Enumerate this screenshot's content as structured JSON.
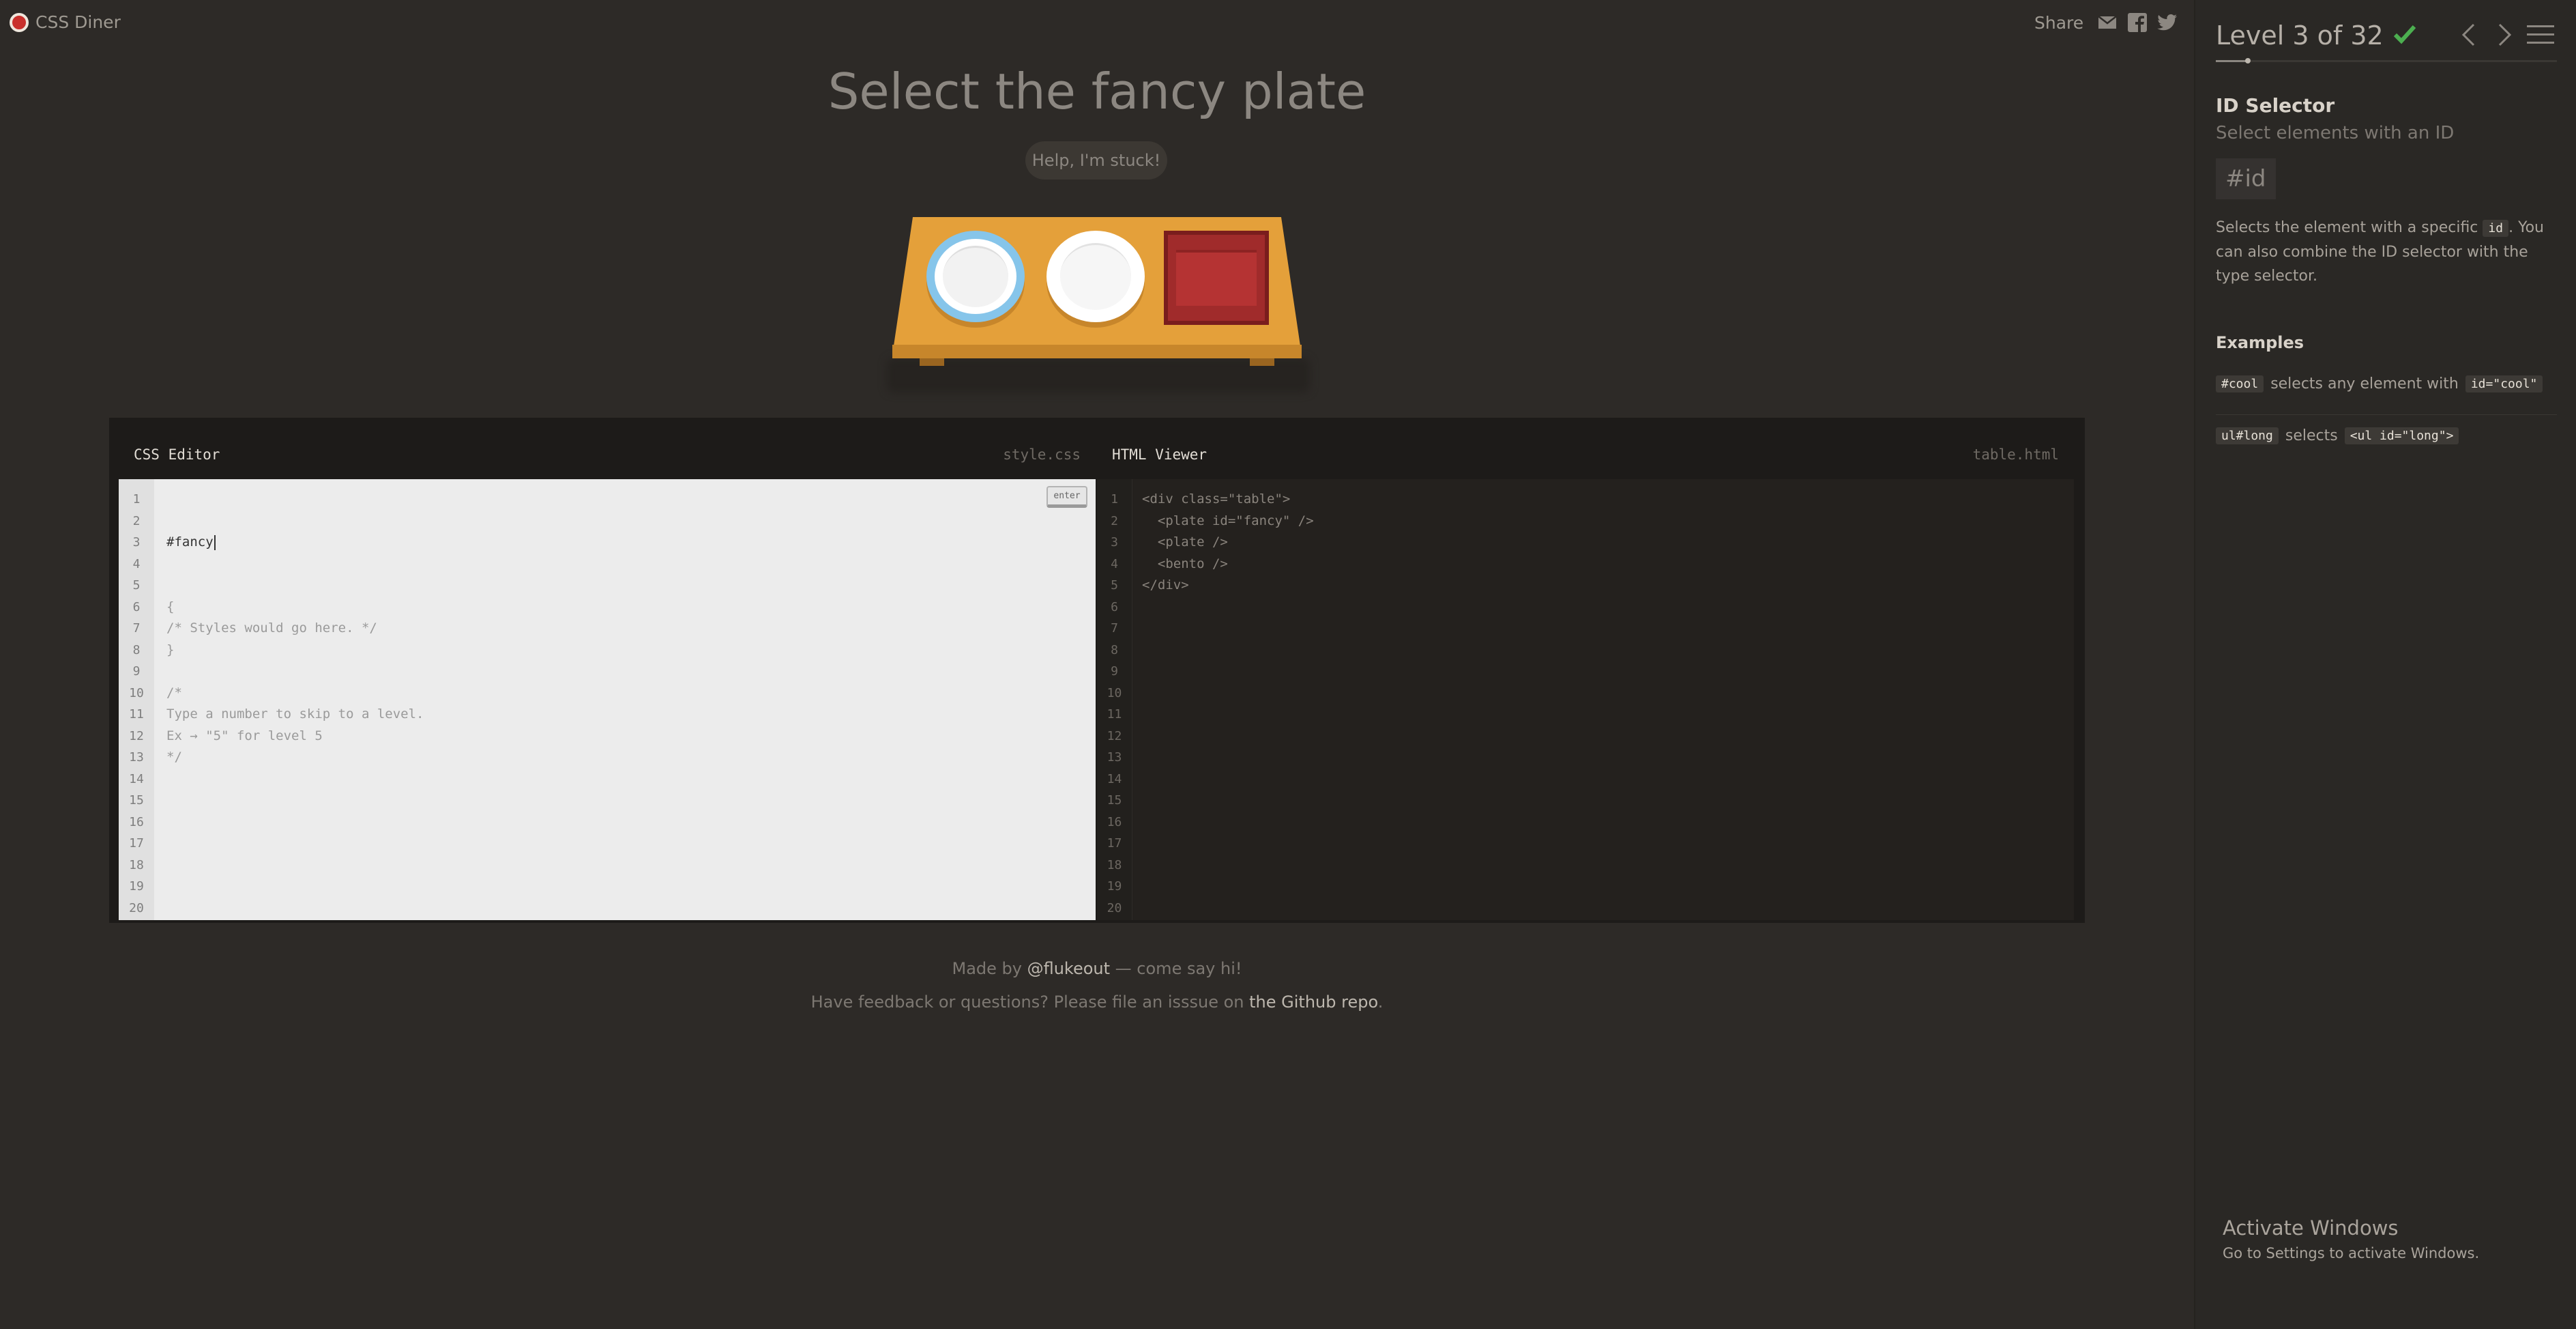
{
  "app": {
    "name": "CSS Diner"
  },
  "share": {
    "label": "Share",
    "icons": [
      "mail-icon",
      "facebook-icon",
      "twitter-icon"
    ]
  },
  "level": {
    "instruction": "Select the fancy plate",
    "help_label": "Help, I'm stuck!",
    "counter": "Level 3 of 32",
    "completed": true,
    "progress_fraction": 0.094
  },
  "css_editor": {
    "title": "CSS Editor",
    "filename": "style.css",
    "enter_label": "enter",
    "input_value": "#fancy",
    "line_numbers": [
      "1",
      "2",
      "3",
      "4",
      "5",
      "6",
      "7",
      "8",
      "9",
      "10",
      "11",
      "12",
      "13",
      "14",
      "15",
      "16",
      "17",
      "18",
      "19",
      "20"
    ],
    "lines": [
      "{",
      "/* Styles would go here. */",
      "}",
      "",
      "/*",
      "Type a number to skip to a level.",
      "Ex → \"5\" for level 5",
      "*/"
    ]
  },
  "html_viewer": {
    "title": "HTML Viewer",
    "filename": "table.html",
    "line_numbers": [
      "1",
      "2",
      "3",
      "4",
      "5",
      "6",
      "7",
      "8",
      "9",
      "10",
      "11",
      "12",
      "13",
      "14",
      "15",
      "16",
      "17",
      "18",
      "19",
      "20"
    ],
    "lines": [
      "<div class=\"table\">",
      "  <plate id=\"fancy\" />",
      "  <plate />",
      "  <bento />",
      "</div>"
    ]
  },
  "footer": {
    "line1_prefix": "Made by ",
    "line1_link": "@flukeout",
    "line1_suffix": " — come say hi!",
    "line2_prefix": "Have feedback or questions? Please file an isssue on ",
    "line2_link": "the Github repo",
    "line2_suffix": "."
  },
  "sidebar": {
    "selector_name": "ID Selector",
    "selector_title": "Select elements with an ID",
    "syntax": "#id",
    "desc_1": "Selects the element with a specific ",
    "desc_tag": "id",
    "desc_2": ". You can also combine the ID selector with the type selector.",
    "examples_heading": "Examples",
    "examples": [
      {
        "code": "#cool",
        "text": "selects any element with",
        "code2": "id=\"cool\""
      },
      {
        "code": "ul#long",
        "text": "selects",
        "code2": "<ul id=\"long\">"
      }
    ]
  },
  "windows_notice": {
    "title": "Activate Windows",
    "subtitle": "Go to Settings to activate Windows."
  },
  "colors": {
    "accent_check": "#4caf50",
    "table": "#e4a03a",
    "bento": "#a02b2b",
    "fancy_plate_rim": "#86c5ea"
  }
}
